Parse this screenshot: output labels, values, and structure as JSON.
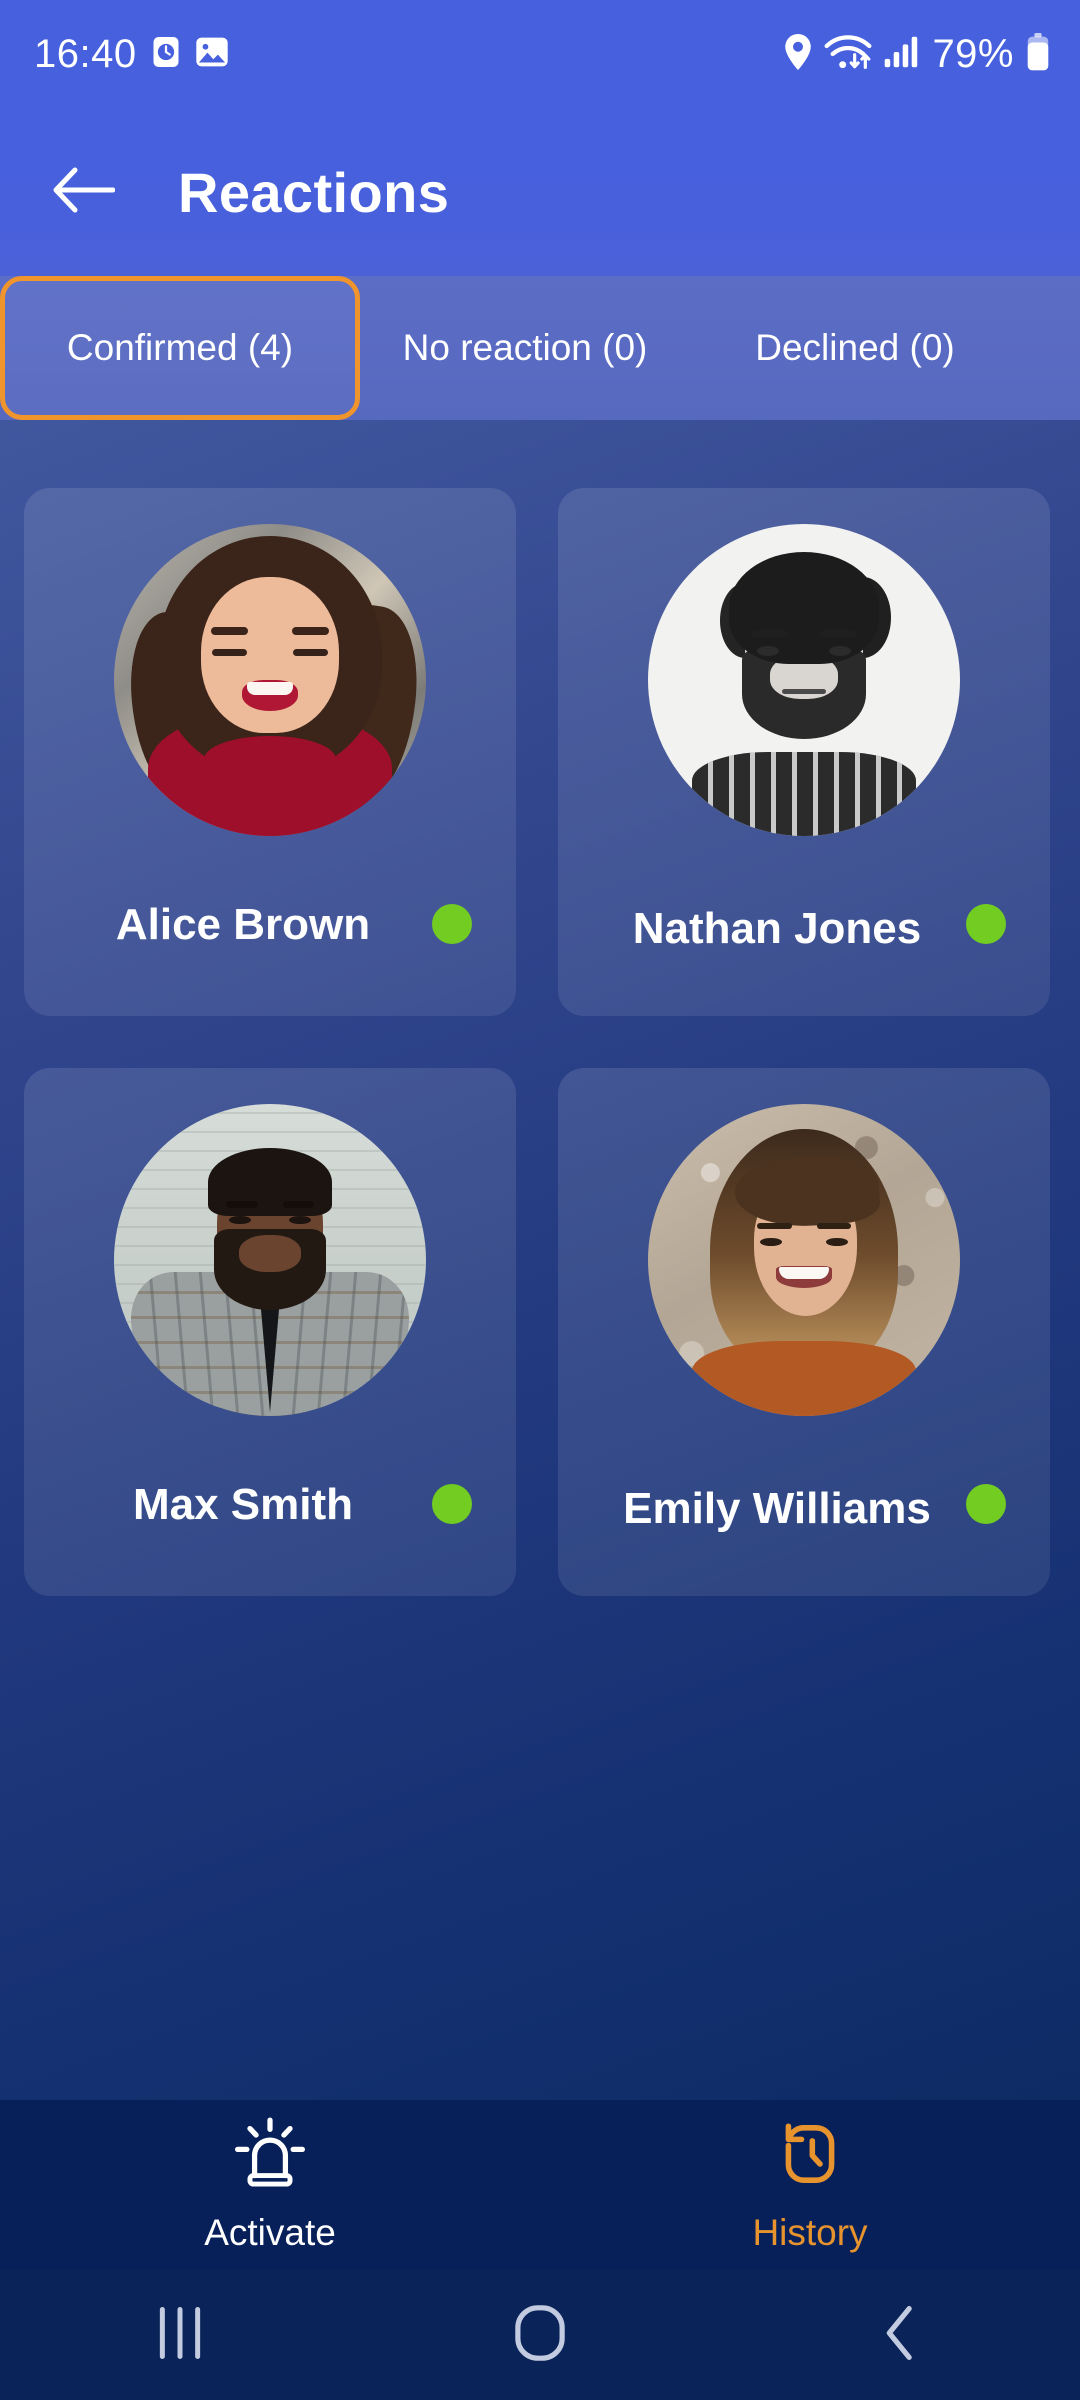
{
  "status_bar": {
    "time": "16:40",
    "battery_percent": "79%",
    "left_icons": [
      "clock-icon",
      "image-icon"
    ],
    "right_icons": [
      "location-pin-icon",
      "wifi-icon",
      "signal-bars-icon",
      "battery-icon"
    ]
  },
  "header": {
    "title": "Reactions",
    "back_icon": "arrow-left-icon"
  },
  "tabs": {
    "accent_color": "#f0952c",
    "items": [
      {
        "label": "Confirmed (4)",
        "count": 4,
        "active": true
      },
      {
        "label": "No reaction (0)",
        "count": 0,
        "active": false
      },
      {
        "label": "Declined (0)",
        "count": 0,
        "active": false
      }
    ]
  },
  "people": {
    "status_dot_color": "#72cc22",
    "items": [
      {
        "name": "Alice Brown",
        "status": "online"
      },
      {
        "name": "Nathan Jones",
        "status": "online"
      },
      {
        "name": "Max Smith",
        "status": "online"
      },
      {
        "name": "Emily Williams",
        "status": "online"
      }
    ]
  },
  "bottom_nav": {
    "active_color": "#e8942e",
    "inactive_color": "#ffffff",
    "items": [
      {
        "label": "Activate",
        "icon": "siren-alarm-icon",
        "active": false
      },
      {
        "label": "History",
        "icon": "clock-history-icon",
        "active": true
      }
    ]
  },
  "system_nav": {
    "recents_icon": "recents-icon",
    "home_icon": "home-icon",
    "back_icon": "back-chevron-icon"
  }
}
